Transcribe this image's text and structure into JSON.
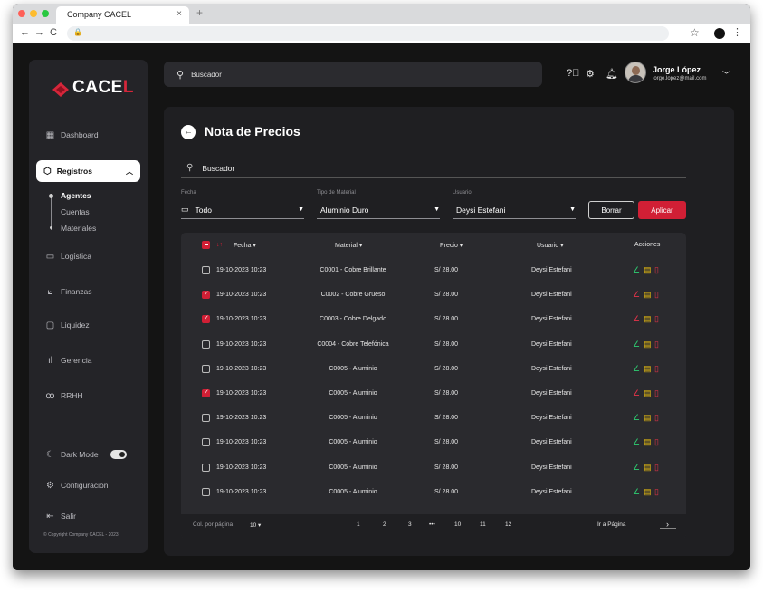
{
  "browser": {
    "tab_title": "Company CACEL",
    "tab_close": "×",
    "new_tab": "+",
    "nav": {
      "back": "←",
      "forward": "→",
      "reload": "C",
      "lock": "🔒",
      "star": "☆",
      "menu": "⋮"
    }
  },
  "brand": {
    "name_white": "CACE",
    "name_red": "L"
  },
  "sidebar": {
    "items": [
      {
        "label": "Dashboard",
        "icon": "grid-icon"
      },
      {
        "label": "Registros",
        "icon": "cube-icon",
        "active": true
      },
      {
        "label": "Logística",
        "icon": "box-icon"
      },
      {
        "label": "Finanzas",
        "icon": "chart-line-icon"
      },
      {
        "label": "Liquidez",
        "icon": "wallet-icon"
      },
      {
        "label": "Gerencia",
        "icon": "bar-chart-icon"
      },
      {
        "label": "RRHH",
        "icon": "people-icon"
      }
    ],
    "subitems": [
      "Agentes",
      "Cuentas",
      "Materiales"
    ],
    "dark_mode": "Dark Mode",
    "config": "Configuración",
    "logout": "Salir",
    "copyright": "© Copyright Company CACEL - 2023"
  },
  "topbar": {
    "search_placeholder": "Buscador",
    "user_name": "Jorge López",
    "user_email": "jorge.lopez@mail.com"
  },
  "page": {
    "title": "Nota de Precios",
    "search_value": "Buscador",
    "filters": {
      "fecha_label": "Fecha",
      "fecha_value": "Todo",
      "material_label": "Tipo de Material",
      "material_value": "Aluminio Duro",
      "usuario_label": "Usuario",
      "usuario_value": "Deysi Estefani",
      "borrar": "Borrar",
      "aplicar": "Aplicar"
    },
    "table": {
      "headers": {
        "fecha": "Fecha",
        "material": "Material",
        "precio": "Precio",
        "usuario": "Usuario",
        "acciones": "Acciones"
      },
      "rows": [
        {
          "fecha": "19-10-2023 10:23",
          "material": "C0001 - Cobre Brillante",
          "precio": "S/ 28.00",
          "usuario": "Deysi Estefani",
          "checked": false
        },
        {
          "fecha": "19-10-2023 10:23",
          "material": "C0002 - Cobre Grueso",
          "precio": "S/ 28.00",
          "usuario": "Deysi Estefani",
          "checked": true
        },
        {
          "fecha": "19-10-2023 10:23",
          "material": "C0003 - Cobre Delgado",
          "precio": "S/ 28.00",
          "usuario": "Deysi Estefani",
          "checked": true
        },
        {
          "fecha": "19-10-2023 10:23",
          "material": "C0004 - Cobre Telefónica",
          "precio": "S/ 28.00",
          "usuario": "Deysi Estefani",
          "checked": false
        },
        {
          "fecha": "19-10-2023 10:23",
          "material": "C0005 - Aluminio",
          "precio": "S/ 28.00",
          "usuario": "Deysi Estefani",
          "checked": false
        },
        {
          "fecha": "19-10-2023 10:23",
          "material": "C0005 - Aluminio",
          "precio": "S/ 28.00",
          "usuario": "Deysi Estefani",
          "checked": true
        },
        {
          "fecha": "19-10-2023 10:23",
          "material": "C0005 - Aluminio",
          "precio": "S/ 28.00",
          "usuario": "Deysi Estefani",
          "checked": false
        },
        {
          "fecha": "19-10-2023 10:23",
          "material": "C0005 - Aluminio",
          "precio": "S/ 28.00",
          "usuario": "Deysi Estefani",
          "checked": false
        },
        {
          "fecha": "19-10-2023 10:23",
          "material": "C0005 - Aluminio",
          "precio": "S/ 28.00",
          "usuario": "Deysi Estefani",
          "checked": false
        },
        {
          "fecha": "19-10-2023 10:23",
          "material": "C0005 - Aluminio",
          "precio": "S/ 28.00",
          "usuario": "Deysi Estefani",
          "checked": false
        }
      ]
    },
    "pagination": {
      "rows_label": "Col. por página",
      "rows_value": "10",
      "pages": [
        "1",
        "2",
        "3",
        "•••",
        "10",
        "11",
        "12"
      ],
      "goto_label": "Ir a Página",
      "next": "›"
    }
  },
  "colors": {
    "accent": "#d11f35",
    "edit": "#2ecc71",
    "note": "#f1c40f",
    "delete": "#e5334a"
  }
}
